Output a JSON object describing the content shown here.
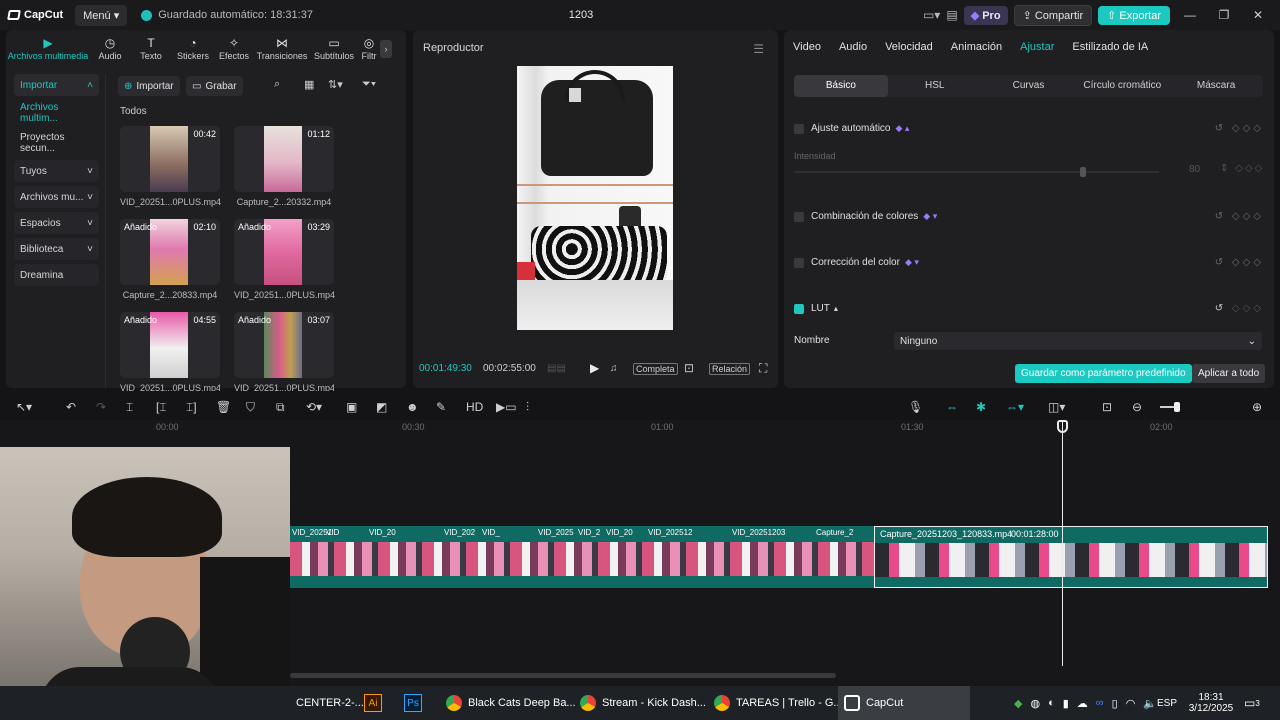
{
  "titlebar": {
    "app_name": "CapCut",
    "menu_label": "Menú",
    "autosave": "Guardado automático: 18:31:37",
    "project_title": "1203",
    "pro_label": "Pro",
    "share_label": "Compartir",
    "export_label": "Exportar"
  },
  "media": {
    "tabs": [
      {
        "label": "Archivos multimedia",
        "icon": "media-icon"
      },
      {
        "label": "Audio",
        "icon": "audio-icon"
      },
      {
        "label": "Texto",
        "icon": "text-icon"
      },
      {
        "label": "Stickers",
        "icon": "sticker-icon"
      },
      {
        "label": "Efectos",
        "icon": "effects-icon"
      },
      {
        "label": "Transiciones",
        "icon": "transition-icon"
      },
      {
        "label": "Subtítulos",
        "icon": "subtitle-icon"
      },
      {
        "label": "Filtr",
        "icon": "filter-icon"
      }
    ],
    "sidebar": [
      {
        "label": "Importar"
      },
      {
        "label": "Archivos multim..."
      },
      {
        "label": "Proyectos secun..."
      },
      {
        "label": "Tuyos"
      },
      {
        "label": "Archivos mu..."
      },
      {
        "label": "Espacios"
      },
      {
        "label": "Biblioteca"
      },
      {
        "label": "Dreamina"
      }
    ],
    "import_label": "Importar",
    "record_label": "Grabar",
    "all_label": "Todos",
    "clips": [
      {
        "name": "VID_20251...0PLUS.mp4",
        "duration": "00:42",
        "added": ""
      },
      {
        "name": "Capture_2...20332.mp4",
        "duration": "01:12",
        "added": ""
      },
      {
        "name": "Capture_2...20833.mp4",
        "duration": "02:10",
        "added": "Añadido"
      },
      {
        "name": "VID_20251...0PLUS.mp4",
        "duration": "03:29",
        "added": "Añadido"
      },
      {
        "name": "VID_20251...0PLUS.mp4",
        "duration": "04:55",
        "added": "Añadido"
      },
      {
        "name": "VID_20251...0PLUS.mp4",
        "duration": "03:07",
        "added": "Añadido"
      }
    ]
  },
  "player": {
    "title": "Reproductor",
    "current_time": "00:01:49:30",
    "total_time": "00:02:55:00",
    "full_label": "Completa",
    "ratio_label": "Relación"
  },
  "inspector": {
    "tabs": [
      "Video",
      "Audio",
      "Velocidad",
      "Animación",
      "Ajustar",
      "Estilizado de IA"
    ],
    "subtabs": [
      "Básico",
      "HSL",
      "Curvas",
      "Círculo cromático",
      "Máscara"
    ],
    "auto_adjust": "Ajuste automático",
    "intensity_label": "Intensidad",
    "intensity_value": "80",
    "color_match": "Combinación de colores",
    "color_correction": "Corrección del color",
    "lut": "LUT",
    "name_label": "Nombre",
    "name_value": "Ninguno",
    "save_preset": "Guardar como parámetro predefinido",
    "apply_all": "Aplicar a todo"
  },
  "timeline": {
    "ticks": [
      "00:00",
      "00:30",
      "01:00",
      "01:30",
      "02:00"
    ],
    "clip_labels": [
      "VID_20251",
      "VID",
      "VID_20",
      "VID_202",
      "VID_",
      "VID_2025",
      "VID_2",
      "VID_20",
      "VID_202512",
      "VID_20251203",
      "Capture_2"
    ],
    "selected_clip": "Capture_20251203_120833.mp4",
    "selected_duration": "00:01:28:00"
  },
  "taskbar": {
    "items": [
      "CENTER-2-...",
      "Black Cats Deep Ba...",
      "Stream - Kick Dash...",
      "TAREAS | Trello - G...",
      "CapCut"
    ],
    "lang": "ESP",
    "time": "18:31",
    "date": "3/12/2025",
    "notif_count": "3"
  },
  "colors": {
    "accent": "#1cc9c0",
    "pro": "#9a7bff",
    "bg": "#141416"
  }
}
